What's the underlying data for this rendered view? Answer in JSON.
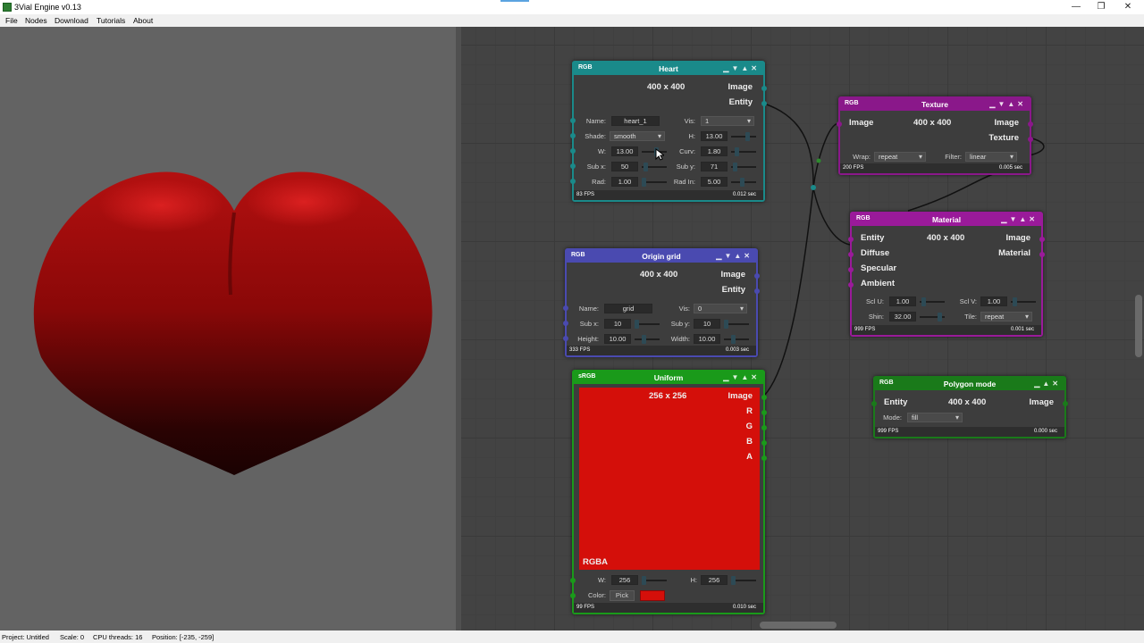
{
  "window": {
    "title": "3Vial Engine v0.13",
    "controls": [
      "—",
      "❐",
      "✕"
    ]
  },
  "menu": [
    "File",
    "Nodes",
    "Download",
    "Tutorials",
    "About"
  ],
  "status": {
    "project": "Project: Untitled",
    "scale": "Scale: 0",
    "threads": "CPU threads: 16",
    "position": "Position: [-235, -259]"
  },
  "colors": {
    "heart": "#1a8a8a",
    "texture": "#8a188a",
    "material": "#9a1a9a",
    "grid": "#4a4ab0",
    "uniform": "#1a9a1a",
    "polygon": "#1a7a1a",
    "swatch": "#d40f0a"
  },
  "nodes": {
    "heart": {
      "cs": "RGB",
      "name": "Heart",
      "dims": "400 x 400",
      "out1": "Image",
      "out2": "Entity",
      "name_lbl": "Name:",
      "name_val": "heart_1",
      "vis_lbl": "Vis:",
      "vis_val": "1",
      "shade_lbl": "Shade:",
      "shade_val": "smooth",
      "h_lbl": "H:",
      "h_val": "13.00",
      "w_lbl": "W:",
      "w_val": "13.00",
      "curv_lbl": "Curv:",
      "curv_val": "1.80",
      "subx_lbl": "Sub x:",
      "subx_val": "50",
      "suby_lbl": "Sub y:",
      "suby_val": "71",
      "rad_lbl": "Rad:",
      "rad_val": "1.00",
      "radin_lbl": "Rad In:",
      "radin_val": "5.00",
      "fps": "83 FPS",
      "sec": "0.012 sec"
    },
    "texture": {
      "cs": "RGB",
      "name": "Texture",
      "dims": "400 x 400",
      "in1": "Image",
      "out1": "Image",
      "out2": "Texture",
      "wrap_lbl": "Wrap:",
      "wrap_val": "repeat",
      "filter_lbl": "Filter:",
      "filter_val": "linear",
      "fps": "200 FPS",
      "sec": "0.005 sec"
    },
    "material": {
      "cs": "RGB",
      "name": "Material",
      "dims": "400 x 400",
      "in1": "Entity",
      "in2": "Diffuse",
      "in3": "Specular",
      "in4": "Ambient",
      "out1": "Image",
      "out2": "Material",
      "sclu_lbl": "Scl U:",
      "sclu_val": "1.00",
      "sclv_lbl": "Scl V:",
      "sclv_val": "1.00",
      "shin_lbl": "Shin:",
      "shin_val": "32.00",
      "tile_lbl": "Tile:",
      "tile_val": "repeat",
      "fps": "999 FPS",
      "sec": "0.001 sec"
    },
    "grid": {
      "cs": "RGB",
      "name": "Origin grid",
      "dims": "400 x 400",
      "out1": "Image",
      "out2": "Entity",
      "name_lbl": "Name:",
      "name_val": "grid",
      "vis_lbl": "Vis:",
      "vis_val": "0",
      "subx_lbl": "Sub x:",
      "subx_val": "10",
      "suby_lbl": "Sub y:",
      "suby_val": "10",
      "height_lbl": "Height:",
      "height_val": "10.00",
      "width_lbl": "Width:",
      "width_val": "10.00",
      "fps": "333 FPS",
      "sec": "0.003 sec"
    },
    "uniform": {
      "cs": "sRGB",
      "name": "Uniform",
      "dims": "256 x 256",
      "out1": "Image",
      "r": "R",
      "g": "G",
      "b": "B",
      "a": "A",
      "fmt": "RGBA",
      "w_lbl": "W:",
      "w_val": "256",
      "h_lbl": "H:",
      "h_val": "256",
      "color_lbl": "Color:",
      "pick": "Pick",
      "fps": "99 FPS",
      "sec": "0.010 sec"
    },
    "polygon": {
      "cs": "RGB",
      "name": "Polygon mode",
      "dims": "400 x 400",
      "in1": "Entity",
      "out1": "Image",
      "mode_lbl": "Mode:",
      "mode_val": "fill",
      "fps": "999 FPS",
      "sec": "0.000 sec"
    }
  }
}
